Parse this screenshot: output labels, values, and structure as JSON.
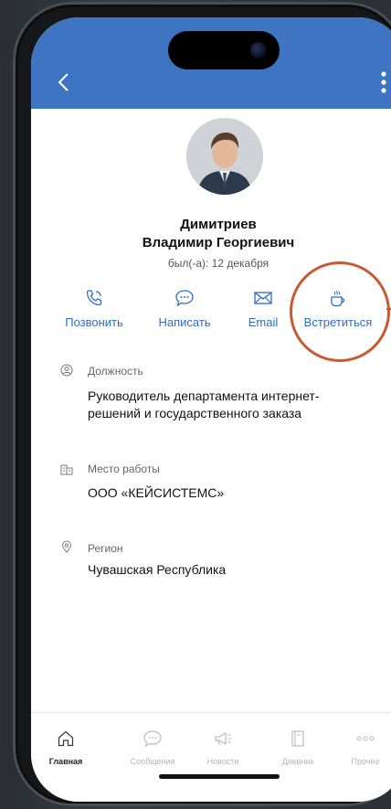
{
  "profile": {
    "last_name": "Димитриев",
    "first_middle": "Владимир Георгиевич",
    "last_seen": "был(-а): 12 декабря"
  },
  "actions": [
    {
      "label": "Позвонить",
      "icon": "phone-icon"
    },
    {
      "label": "Написать",
      "icon": "chat-icon"
    },
    {
      "label": "Email",
      "icon": "mail-icon"
    },
    {
      "label": "Встретиться",
      "icon": "coffee-cup-icon"
    }
  ],
  "info": {
    "position_label": "Должность",
    "position_value": "Руководитель департамента интернет-решений и государственного заказа",
    "workplace_label": "Место работы",
    "workplace_value": "ООО «КЕЙСИСТЕМС»",
    "region_label": "Регион",
    "region_value": "Чувашская Республика"
  },
  "tabs": [
    {
      "label": "Главная",
      "icon": "home-icon",
      "active": true
    },
    {
      "label": "Сообщения",
      "icon": "chat-icon",
      "active": false
    },
    {
      "label": "Новости",
      "icon": "megaphone-icon",
      "active": false
    },
    {
      "label": "Дневник",
      "icon": "notebook-icon",
      "active": false
    },
    {
      "label": "Прочее",
      "icon": "dots-icon",
      "active": false
    }
  ],
  "colors": {
    "header": "#3e74c1",
    "accent": "#2f6cc4",
    "highlight": "#c75a31"
  }
}
